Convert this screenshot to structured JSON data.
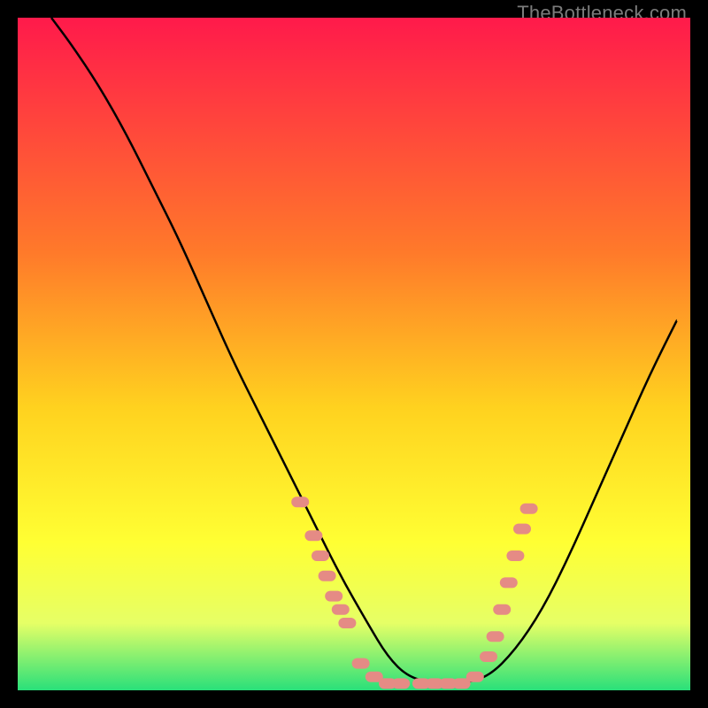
{
  "watermark": "TheBottleneck.com",
  "colors": {
    "bg": "#000000",
    "gradient_top": "#ff1a4b",
    "gradient_mid1": "#ff7a2a",
    "gradient_mid2": "#ffd21f",
    "gradient_mid3": "#ffff33",
    "gradient_low": "#e6ff66",
    "gradient_bottom": "#29e07a",
    "curve": "#000000",
    "marker": "#e58b85"
  },
  "chart_data": {
    "type": "line",
    "title": "",
    "xlabel": "",
    "ylabel": "",
    "xlim": [
      0,
      100
    ],
    "ylim": [
      0,
      100
    ],
    "series": [
      {
        "name": "bottleneck-curve",
        "x": [
          5,
          8,
          12,
          16,
          20,
          24,
          28,
          32,
          36,
          40,
          44,
          48,
          52,
          55,
          58,
          62,
          66,
          70,
          74,
          78,
          82,
          86,
          90,
          94,
          98
        ],
        "y": [
          100,
          96,
          90,
          83,
          75,
          67,
          58,
          49,
          41,
          33,
          25,
          17,
          10,
          5,
          2,
          1,
          1,
          2,
          6,
          12,
          20,
          29,
          38,
          47,
          55
        ]
      }
    ],
    "markers": [
      {
        "x": 42,
        "y": 28
      },
      {
        "x": 44,
        "y": 23
      },
      {
        "x": 45,
        "y": 20
      },
      {
        "x": 46,
        "y": 17
      },
      {
        "x": 47,
        "y": 14
      },
      {
        "x": 48,
        "y": 12
      },
      {
        "x": 49,
        "y": 10
      },
      {
        "x": 51,
        "y": 4
      },
      {
        "x": 53,
        "y": 2
      },
      {
        "x": 55,
        "y": 1
      },
      {
        "x": 57,
        "y": 1
      },
      {
        "x": 60,
        "y": 1
      },
      {
        "x": 62,
        "y": 1
      },
      {
        "x": 64,
        "y": 1
      },
      {
        "x": 66,
        "y": 1
      },
      {
        "x": 68,
        "y": 2
      },
      {
        "x": 70,
        "y": 5
      },
      {
        "x": 71,
        "y": 8
      },
      {
        "x": 72,
        "y": 12
      },
      {
        "x": 73,
        "y": 16
      },
      {
        "x": 74,
        "y": 20
      },
      {
        "x": 75,
        "y": 24
      },
      {
        "x": 76,
        "y": 27
      }
    ]
  }
}
